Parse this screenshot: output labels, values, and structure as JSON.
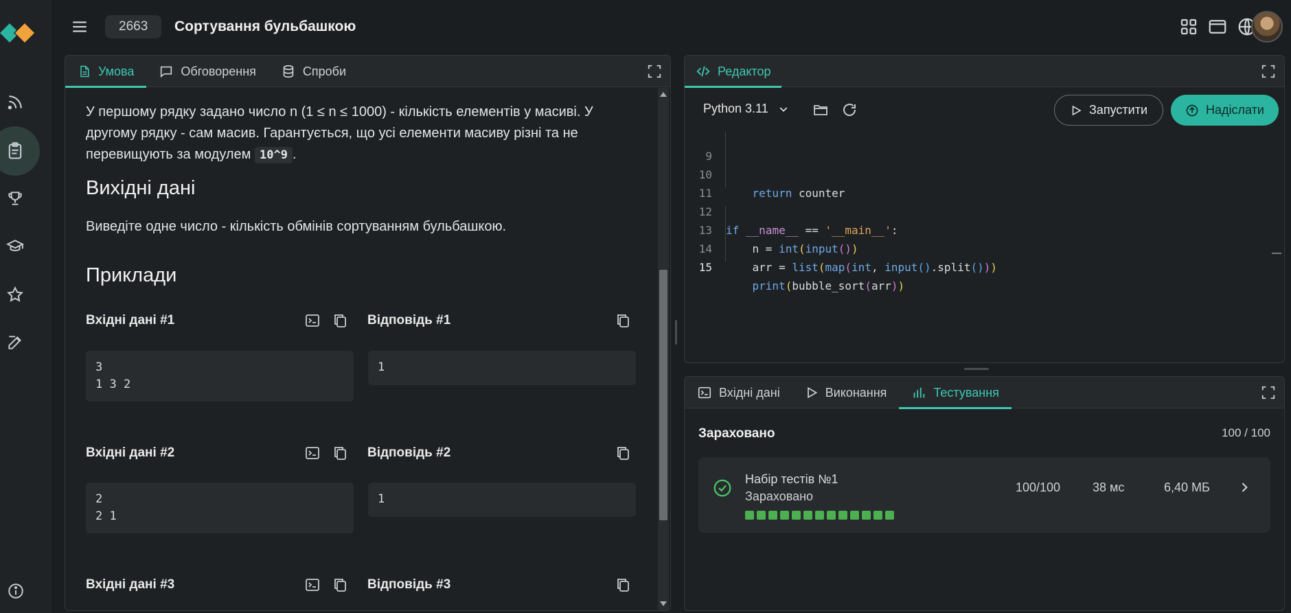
{
  "header": {
    "task_id": "2663",
    "task_title": "Сортування бульбашкою"
  },
  "problem_panel": {
    "tabs": [
      {
        "label": "Умова",
        "active": true
      },
      {
        "label": "Обговорення",
        "active": false
      },
      {
        "label": "Спроби",
        "active": false
      }
    ],
    "input_text_part1": "У першому рядку задано число n (1 ≤ n ≤ 1000) - кількість елементів у масиві. У другому рядку - сам масив. Гарантується, що усі елементи масиву різні та не перевищують за модулем ",
    "input_text_code": "10^9",
    "input_text_part2": ".",
    "output_heading": "Вихідні дані",
    "output_text": "Виведіте одне число - кількість обмінів сортуванням бульбашкою.",
    "examples_heading": "Приклади",
    "examples": [
      {
        "input_label": "Вхідні дані #1",
        "input": "3\n1 3 2",
        "answer_label": "Відповідь #1",
        "answer": "1"
      },
      {
        "input_label": "Вхідні дані #2",
        "input": "2\n2 1",
        "answer_label": "Відповідь #2",
        "answer": "1"
      },
      {
        "input_label": "Вхідні дані #3",
        "input": "",
        "answer_label": "Відповідь #3",
        "answer": ""
      }
    ]
  },
  "editor": {
    "tab_label": "Редактор",
    "language": "Python 3.11",
    "run_label": "Запустити",
    "submit_label": "Надіслати",
    "lines": [
      {
        "n": "9",
        "text": ""
      },
      {
        "n": "10",
        "text": "    return counter"
      },
      {
        "n": "11",
        "text": ""
      },
      {
        "n": "12",
        "text": "if __name__ == '__main__':"
      },
      {
        "n": "13",
        "text": "    n = int(input())"
      },
      {
        "n": "14",
        "text": "    arr = list(map(int, input().split()))"
      },
      {
        "n": "15",
        "text": "    print(bubble_sort(arr))"
      }
    ]
  },
  "results": {
    "tabs": [
      {
        "label": "Вхідні дані",
        "active": false
      },
      {
        "label": "Виконання",
        "active": false
      },
      {
        "label": "Тестування",
        "active": true
      }
    ],
    "status": "Зараховано",
    "score": "100 / 100",
    "test_set": {
      "name": "Набір тестів №1",
      "status": "Зараховано",
      "score": "100/100",
      "time": "38 мс",
      "memory": "6,40 МБ",
      "passed_tests": 13
    }
  },
  "colors": {
    "accent": "#3ec7b3",
    "submit": "#2bb5a0",
    "success": "#4caf50"
  }
}
